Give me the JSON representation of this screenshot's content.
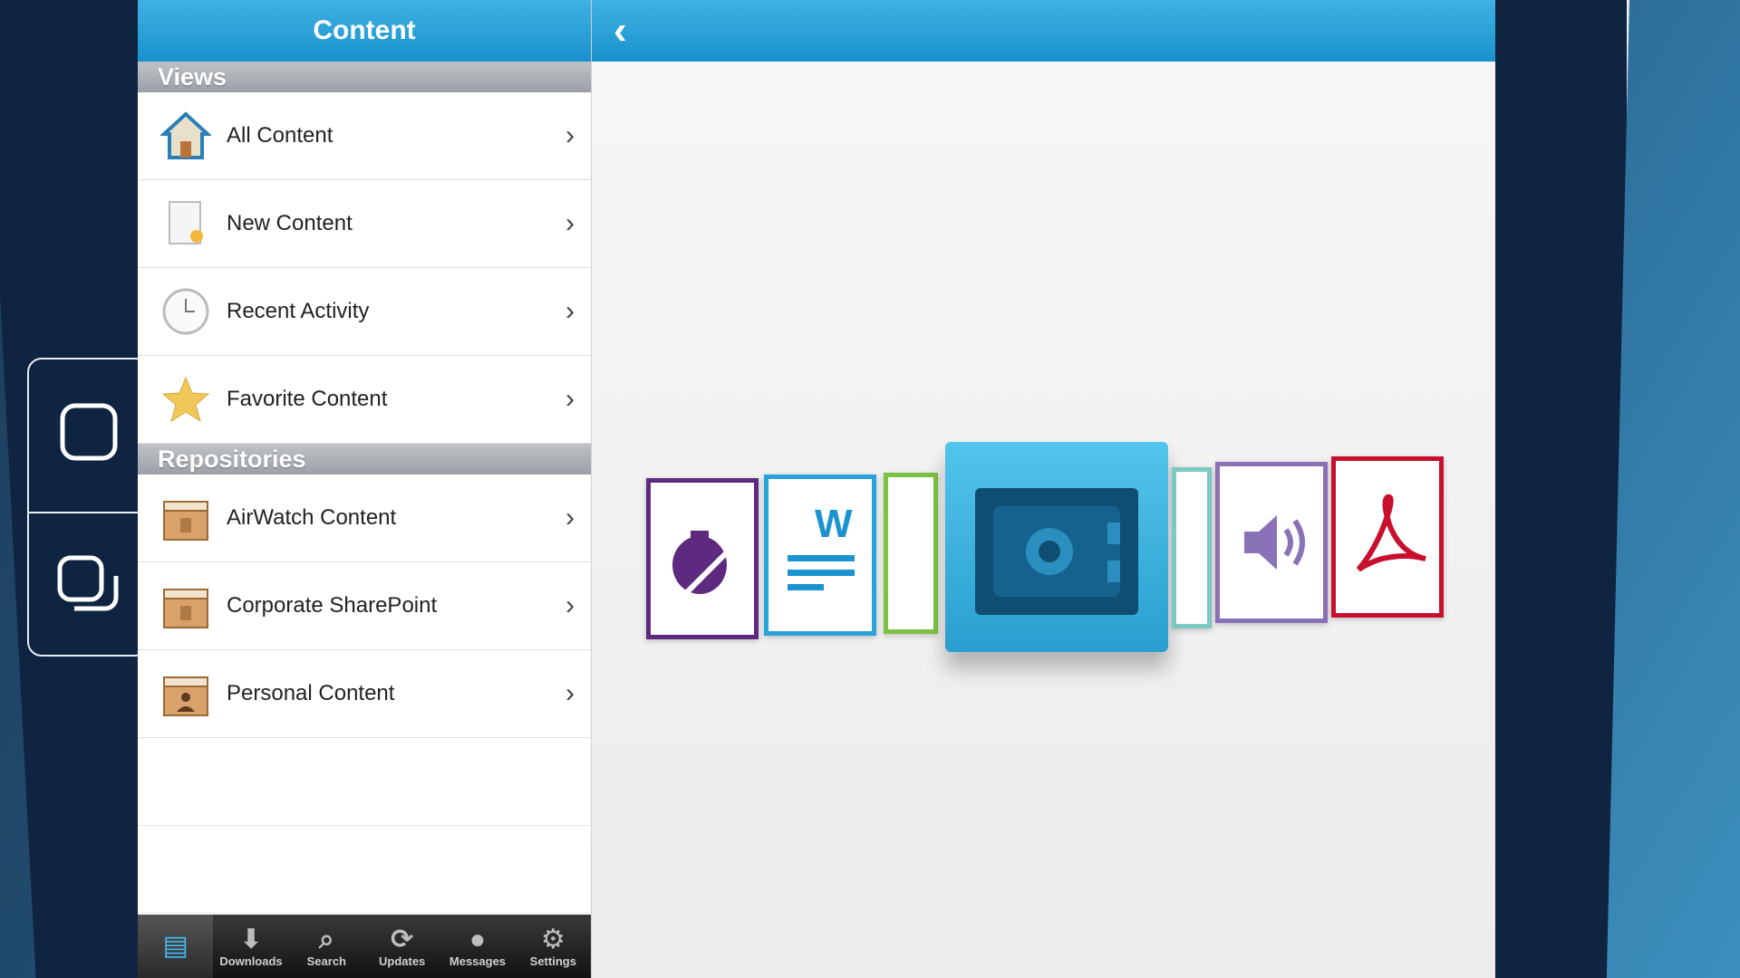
{
  "left_pane": {
    "header_title": "Content",
    "views_section": "Views",
    "views": [
      {
        "label": "All Content"
      },
      {
        "label": "New Content"
      },
      {
        "label": "Recent Activity"
      },
      {
        "label": "Favorite Content"
      }
    ],
    "repositories_section": "Repositories",
    "repositories": [
      {
        "label": "AirWatch Content"
      },
      {
        "label": "Corporate SharePoint"
      },
      {
        "label": "Personal Content"
      }
    ]
  },
  "tabbar": {
    "tabs": [
      {
        "label": "",
        "icon": "content-icon",
        "active": true
      },
      {
        "label": "Downloads",
        "icon": "download-icon"
      },
      {
        "label": "Search",
        "icon": "search-icon"
      },
      {
        "label": "Updates",
        "icon": "refresh-icon"
      },
      {
        "label": "Messages",
        "icon": "message-icon"
      },
      {
        "label": "Settings",
        "icon": "gear-icon"
      }
    ]
  },
  "right_pane": {
    "back_icon": "chevron-left-icon",
    "tiles": [
      "note-icon",
      "word-document-icon",
      "image-icon",
      "content-vault-icon",
      "video-icon",
      "audio-icon",
      "pdf-icon"
    ]
  },
  "colors": {
    "header_blue": "#1991cc",
    "vault_blue": "#2a9fcf",
    "pdf_red": "#c8102e",
    "audio_purple": "#8a72b8",
    "note_purple": "#5e2a80"
  }
}
